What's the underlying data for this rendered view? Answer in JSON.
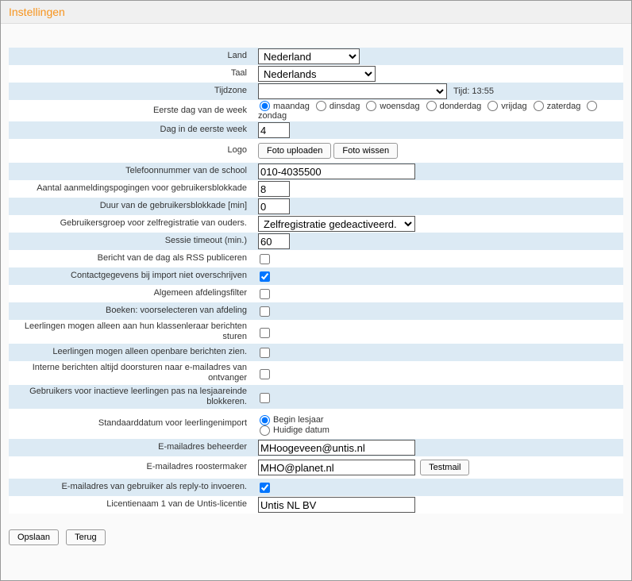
{
  "title": "Instellingen",
  "labels": {
    "land": "Land",
    "taal": "Taal",
    "tijdzone": "Tijdzone",
    "tijd": "Tijd: 13:55",
    "eerste_dag": "Eerste dag van de week",
    "dag_eerste_week": "Dag in de eerste week",
    "logo": "Logo",
    "telefoon": "Telefoonnummer van de school",
    "aanmeldpogingen": "Aantal aanmeldingspogingen voor gebruikersblokkade",
    "blokkade_duur": "Duur van de gebruikersblokkade [min]",
    "zelfregistratie": "Gebruikersgroep voor zelfregistratie van ouders.",
    "sessie_timeout": "Sessie timeout (min.)",
    "rss": "Bericht van de dag als RSS publiceren",
    "contact_import": "Contactgegevens bij import niet overschrijven",
    "afdelingsfilter": "Algemeen afdelingsfilter",
    "boeken_voorselect": "Boeken: voorselecteren van afdeling",
    "leerling_klassenleraar": "Leerlingen mogen alleen aan hun klassenleraar berichten sturen",
    "leerling_openbaar": "Leerlingen mogen alleen openbare berichten zien.",
    "interne_doorsturen": "Interne berichten altijd doorsturen naar e-mailadres van ontvanger",
    "inactieve_blokkeren": "Gebruikers voor inactieve leerlingen pas na lesjaareinde blokkeren.",
    "standaarddatum": "Standaarddatum voor leerlingenimport",
    "email_beheerder": "E-mailadres beheerder",
    "email_roostermaker": "E-mailadres roostermaker",
    "email_replyto": "E-mailadres van gebruiker als reply-to invoeren.",
    "licentienaam": "Licentienaam 1 van de Untis-licentie"
  },
  "values": {
    "land": "Nederland",
    "taal": "Nederlands",
    "tijdzone": "",
    "dag_eerste_week": "4",
    "telefoon": "010-4035500",
    "aanmeldpogingen": "8",
    "blokkade_duur": "0",
    "zelfregistratie": "Zelfregistratie gedeactiveerd.",
    "sessie_timeout": "60",
    "email_beheerder": "MHoogeveen@untis.nl",
    "email_roostermaker": "MHO@planet.nl",
    "licentienaam": "Untis NL BV"
  },
  "weekdays": {
    "maandag": "maandag",
    "dinsdag": "dinsdag",
    "woensdag": "woensdag",
    "donderdag": "donderdag",
    "vrijdag": "vrijdag",
    "zaterdag": "zaterdag",
    "zondag": "zondag"
  },
  "buttons": {
    "foto_upload": "Foto uploaden",
    "foto_wissen": "Foto wissen",
    "testmail": "Testmail",
    "opslaan": "Opslaan",
    "terug": "Terug"
  },
  "radio_import": {
    "begin": "Begin lesjaar",
    "huidig": "Huidige datum"
  }
}
